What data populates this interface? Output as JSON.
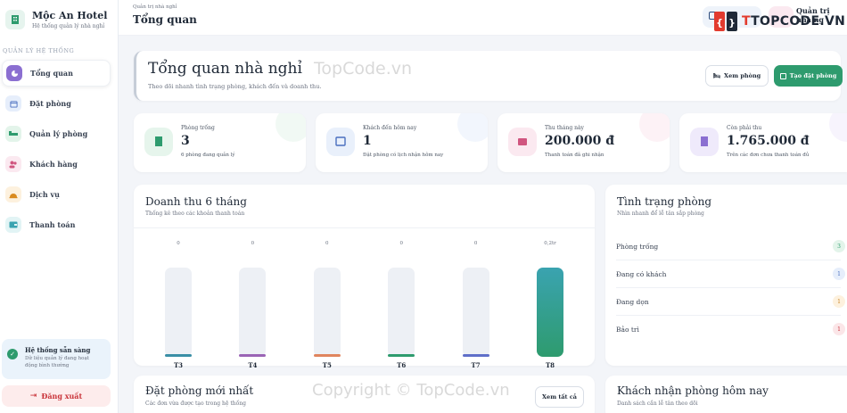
{
  "brand": {
    "name": "Mộc An Hotel",
    "subtitle": "Hệ thống quản lý nhà nghỉ"
  },
  "sidebar": {
    "section_label": "QUẢN LÝ HỆ THỐNG",
    "items": [
      {
        "label": "Tổng quan",
        "icon": "dashboard-icon",
        "active": true
      },
      {
        "label": "Đặt phòng",
        "icon": "calendar-icon"
      },
      {
        "label": "Quản lý phòng",
        "icon": "bed-icon"
      },
      {
        "label": "Khách hàng",
        "icon": "users-icon"
      },
      {
        "label": "Dịch vụ",
        "icon": "bell-icon"
      },
      {
        "label": "Thanh toán",
        "icon": "wallet-icon"
      }
    ],
    "system_status": {
      "title": "Hệ thống sẵn sàng",
      "desc": "Dữ liệu quản lý đang hoạt động bình thường"
    },
    "logout_label": "Đăng xuất"
  },
  "header": {
    "breadcrumb": "Quản trị nhà nghỉ",
    "title": "Tổng quan",
    "user_name": "Quản trị nhà ng"
  },
  "hero": {
    "title": "Tổng quan nhà nghỉ",
    "subtitle": "Theo dõi nhanh tình trạng phòng, khách đến và doanh thu.",
    "view_rooms_label": "Xem phòng",
    "create_booking_label": "Tạo đặt phòng"
  },
  "stats": [
    {
      "label": "Phòng trống",
      "value": "3",
      "sub": "6 phòng đang quản lý",
      "color": "#e6f5ec",
      "deco": "#e9f6ee"
    },
    {
      "label": "Khách đến hôm nay",
      "value": "1",
      "sub": "Đặt phòng có lịch nhận hôm nay",
      "color": "#e9f0fb",
      "deco": "#eaf0fb"
    },
    {
      "label": "Thu tháng này",
      "value": "200.000 đ",
      "sub": "Thanh toán đã ghi nhận",
      "color": "#fbe9f0",
      "deco": "#fcebf1"
    },
    {
      "label": "Còn phải thu",
      "value": "1.765.000 đ",
      "sub": "Trên các đơn chưa thanh toán đủ",
      "color": "#efeafb",
      "deco": "#f0ebfb"
    }
  ],
  "revenue": {
    "title": "Doanh thu 6 tháng",
    "subtitle": "Thống kê theo các khoản thanh toán"
  },
  "chart_data": {
    "type": "bar",
    "categories": [
      "T3",
      "T4",
      "T5",
      "T6",
      "T7",
      "T8"
    ],
    "values": [
      0,
      0,
      0,
      0,
      0,
      0.2
    ],
    "value_labels": [
      "0",
      "0",
      "0",
      "0",
      "0",
      "0,2tr"
    ],
    "colors": [
      "#3a8fa6",
      "#9a64b5",
      "#e0855e",
      "#2e9b6e",
      "#5f6fc9",
      "#2e9b6e"
    ],
    "title": "Doanh thu 6 tháng",
    "xlabel": "",
    "ylabel": ""
  },
  "room_status": {
    "title": "Tình trạng phòng",
    "subtitle": "Nhìn nhanh để lễ tân sắp phòng",
    "rows": [
      {
        "label": "Phòng trống",
        "count": "3",
        "bg": "#e3f4ea",
        "fg": "#2e9b6e"
      },
      {
        "label": "Đang có khách",
        "count": "1",
        "bg": "#e6eefb",
        "fg": "#4a6fbf"
      },
      {
        "label": "Đang dọn",
        "count": "1",
        "bg": "#fdf1de",
        "fg": "#c9862a"
      },
      {
        "label": "Bảo trì",
        "count": "1",
        "bg": "#fbe6e8",
        "fg": "#c9353b"
      }
    ]
  },
  "recent_bookings": {
    "title": "Đặt phòng mới nhất",
    "subtitle": "Các đơn vừa được tạo trong hệ thống",
    "view_all_label": "Xem tất cả"
  },
  "checkins_today": {
    "title": "Khách nhận phòng hôm nay",
    "subtitle": "Danh sách cần lễ tân theo dõi"
  },
  "watermarks": {
    "top": "TopCode.vn",
    "bottom": "Copyright © TopCode.vn",
    "logo": "TOPCODE.VN"
  }
}
